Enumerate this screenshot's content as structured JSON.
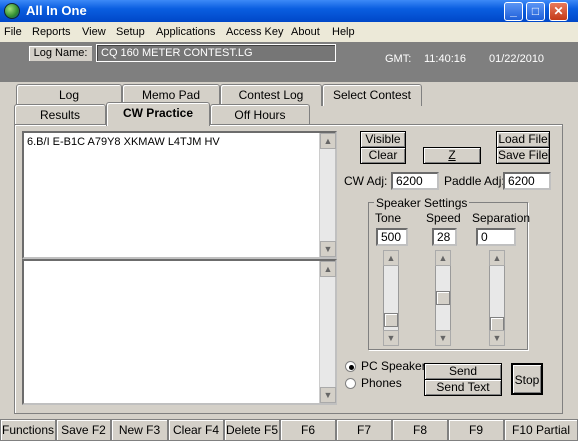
{
  "window": {
    "title": "All In One",
    "minimize": "_",
    "maximize": "□",
    "close": "✕"
  },
  "menu": [
    "File",
    "Reports",
    "View",
    "Setup",
    "Applications",
    "Access Key",
    "About",
    "Help"
  ],
  "info": {
    "log_name_label": "Log Name:",
    "log_name_value": "CQ 160 METER CONTEST.LG",
    "gmt_label": "GMT:",
    "time": "11:40:16",
    "date": "01/22/2010"
  },
  "tabs_back": [
    "Log",
    "Memo Pad",
    "Contest Log",
    "Select Contest"
  ],
  "tabs_front": [
    "Results",
    "CW Practice",
    "Off Hours"
  ],
  "practice": {
    "text": "6.B/I  E-B1C  A79Y8  XKMAW  L4TJM  HV",
    "visible_btn": "Visible",
    "clear_btn": "Clear",
    "z_btn": "Z",
    "load_btn": "Load File",
    "save_btn": "Save File",
    "cw_adj_label": "CW Adj:",
    "cw_adj_value": "6200",
    "paddle_adj_label": "Paddle Adj:",
    "paddle_adj_value": "6200"
  },
  "speaker": {
    "group_label": "Speaker Settings",
    "tone_label": "Tone",
    "tone_value": "500",
    "speed_label": "Speed",
    "speed_value": "28",
    "separation_label": "Separation",
    "separation_value": "0"
  },
  "output": {
    "pc_speaker": "PC Speaker",
    "phones": "Phones",
    "selected": "PC Speaker"
  },
  "actions": {
    "send_random": "Send Random",
    "send_text": "Send Text",
    "stop": "Stop"
  },
  "function_keys": [
    "Functions",
    "Save F2",
    "New F3",
    "Clear F4",
    "Delete F5",
    "F6",
    "F7",
    "F8",
    "F9",
    "F10 Partial"
  ]
}
